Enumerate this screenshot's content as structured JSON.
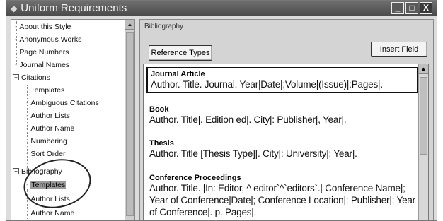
{
  "window": {
    "title": "Uniform Requirements",
    "controls": [
      "minimize-icon",
      "maximize-icon",
      "close-icon"
    ]
  },
  "tree": {
    "items": [
      {
        "label": "About this Style",
        "level": 0
      },
      {
        "label": "Anonymous Works",
        "level": 0
      },
      {
        "label": "Page Numbers",
        "level": 0
      },
      {
        "label": "Journal Names",
        "level": 0
      },
      {
        "label": "Citations",
        "level": 0,
        "expander": "−"
      },
      {
        "label": "Templates",
        "level": 1
      },
      {
        "label": "Ambiguous Citations",
        "level": 1
      },
      {
        "label": "Author Lists",
        "level": 1
      },
      {
        "label": "Author Name",
        "level": 1
      },
      {
        "label": "Numbering",
        "level": 1
      },
      {
        "label": "Sort Order",
        "level": 1
      },
      {
        "label": "Bibliography",
        "level": 0,
        "expander": "−"
      },
      {
        "label": "Templates",
        "level": 1,
        "selected": true
      },
      {
        "label": "Author Lists",
        "level": 1
      },
      {
        "label": "Author Name",
        "level": 1
      }
    ]
  },
  "panel": {
    "group_label": "Bibliography",
    "reference_types_button": "Reference Types",
    "insert_field_button": "Insert Field",
    "entries": [
      {
        "title": "Journal Article",
        "template": "Author. Title. Journal. Year|Date|;Volume|(Issue)|:Pages|.",
        "selected": true
      },
      {
        "title": "Book",
        "template": "Author. Title|. Edition ed|. City|: Publisher|, Year|."
      },
      {
        "title": "Thesis",
        "template": "Author. Title [Thesis Type]|. City|: University|; Year|."
      },
      {
        "title": "Conference Proceedings",
        "template": "Author. Title. |In: Editor, ^ editor`^`editors`.| Conference Name|; Year of Conference|Date|; Conference Location|: Publisher|; Year of Conference|. p. Pages|."
      }
    ]
  },
  "colors": {
    "titlebar": "#4a4a4a",
    "panel_bg": "#d4d4d4",
    "selection": "#9a9a9a"
  }
}
